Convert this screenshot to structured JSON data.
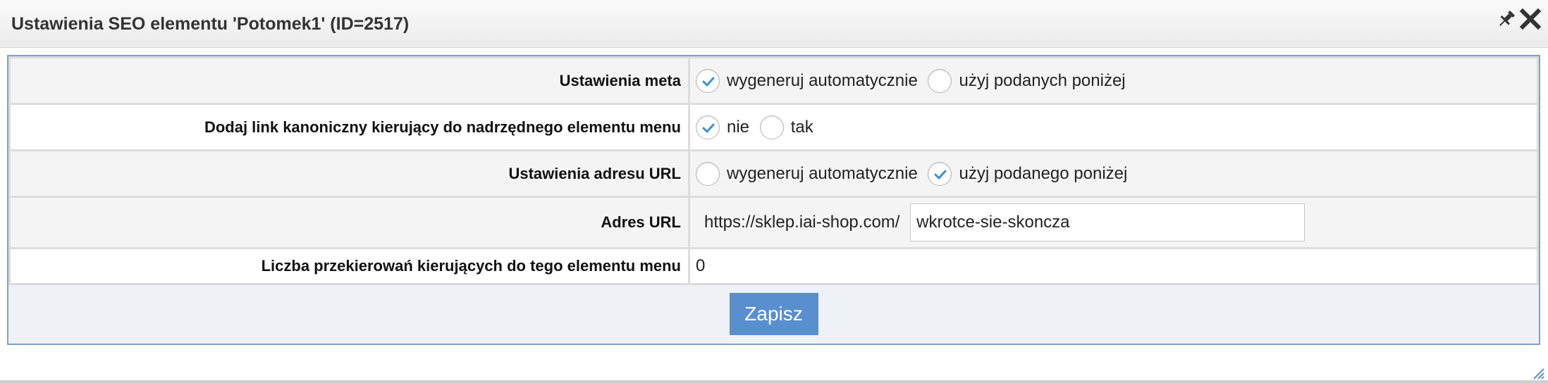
{
  "dialog": {
    "title": "Ustawienia SEO elementu 'Potomek1' (ID=2517)",
    "icons": {
      "pin": "pin-icon",
      "close": "close-icon",
      "resize": "resize-grip-icon"
    }
  },
  "rows": {
    "meta": {
      "label": "Ustawienia meta",
      "options": [
        {
          "label": "wygeneruj automatycznie",
          "checked": true
        },
        {
          "label": "użyj podanych poniżej",
          "checked": false
        }
      ]
    },
    "canonical": {
      "label": "Dodaj link kanoniczny kierujący do nadrzędnego elementu menu",
      "options": [
        {
          "label": "nie",
          "checked": true
        },
        {
          "label": "tak",
          "checked": false
        }
      ]
    },
    "url_settings": {
      "label": "Ustawienia adresu URL",
      "options": [
        {
          "label": "wygeneruj automatycznie",
          "checked": false
        },
        {
          "label": "użyj podanego poniżej",
          "checked": true
        }
      ]
    },
    "url": {
      "label": "Adres URL",
      "prefix": "https://sklep.iai-shop.com/",
      "value": "wkrotce-sie-skoncza"
    },
    "redirects": {
      "label": "Liczba przekierowań kierujących do tego elementu menu",
      "value": "0"
    }
  },
  "footer": {
    "save_label": "Zapisz"
  },
  "colors": {
    "accent": "#5a8fcf",
    "check": "#3b8fd6",
    "panel_border": "#7ea0cc"
  }
}
